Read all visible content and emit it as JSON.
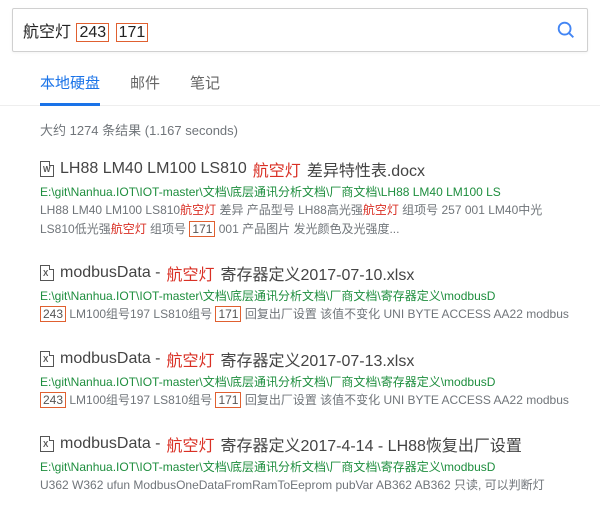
{
  "search": {
    "prefix": "航空灯",
    "term1": "243",
    "term2": "171",
    "icon_name": "search-icon"
  },
  "tabs": [
    {
      "label": "本地硬盘",
      "active": true
    },
    {
      "label": "邮件",
      "active": false
    },
    {
      "label": "笔记",
      "active": false
    }
  ],
  "stats": {
    "text": "大约  1274  条结果 (1.167 seconds)"
  },
  "results": [
    {
      "doc_type": "W",
      "title_parts": [
        "LH88 LM40 LM100 LS810",
        "航空灯",
        "差异特性表.docx"
      ],
      "path_parts": [
        "E:\\git\\Nanhua.IOT\\IOT-master\\文档\\底层通讯分析文档\\厂商文档\\LH88 LM40 LM100 LS"
      ],
      "snippet": [
        {
          "t": "LH88 LM40 LM100 LS810"
        },
        {
          "t": "航空灯",
          "red": true
        },
        {
          "t": " 差异 产品型号 LH88高光强"
        },
        {
          "t": "航空灯",
          "red": true
        },
        {
          "t": " 组项号 257 001 LM40中光"
        },
        {
          "br": true
        },
        {
          "t": "LS810低光强"
        },
        {
          "t": "航空灯",
          "red": true
        },
        {
          "t": " 组项号 "
        },
        {
          "t": "171",
          "box": true
        },
        {
          "t": " 001 产品图片 发光颜色及光强度..."
        }
      ]
    },
    {
      "doc_type": "X",
      "title_parts": [
        "modbusData - ",
        "航空灯",
        "寄存器定义2017-07-10.xlsx"
      ],
      "path_parts": [
        "E:\\git\\Nanhua.IOT\\IOT-master\\文档\\底层通讯分析文档\\厂商文档\\寄存器定义\\modbusD"
      ],
      "snippet": [
        {
          "t": "243",
          "box": true
        },
        {
          "t": " LM100组号197 LS810组号 "
        },
        {
          "t": "171",
          "box": true
        },
        {
          "t": " 回复出厂设置 该值不变化 UNI BYTE ACCESS AA22 modbus"
        }
      ]
    },
    {
      "doc_type": "X",
      "title_parts": [
        "modbusData - ",
        "航空灯",
        "寄存器定义2017-07-13.xlsx"
      ],
      "path_parts": [
        "E:\\git\\Nanhua.IOT\\IOT-master\\文档\\底层通讯分析文档\\厂商文档\\寄存器定义\\modbusD"
      ],
      "snippet": [
        {
          "t": "243",
          "box": true
        },
        {
          "t": " LM100组号197 LS810组号 "
        },
        {
          "t": "171",
          "box": true
        },
        {
          "t": " 回复出厂设置 该值不变化 UNI BYTE ACCESS AA22 modbus"
        }
      ]
    },
    {
      "doc_type": "X",
      "title_parts": [
        "modbusData - ",
        "航空灯",
        "寄存器定义2017-4-14 - LH88恢复出厂设置"
      ],
      "path_parts": [
        "E:\\git\\Nanhua.IOT\\IOT-master\\文档\\底层通讯分析文档\\厂商文档\\寄存器定义\\modbusD"
      ],
      "snippet": [
        {
          "t": "U362 W362 ufun ModbusOneDataFromRamToEeprom pubVar AB362 AB362  只读, 可以判断灯"
        }
      ]
    }
  ]
}
